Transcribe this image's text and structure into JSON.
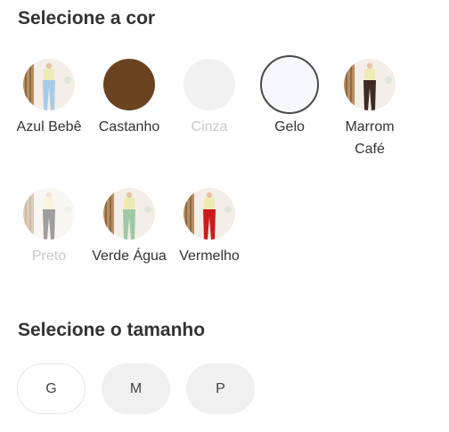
{
  "color_section": {
    "title": "Selecione a cor",
    "options": [
      {
        "label": "Azul Bebê",
        "kind": "photo",
        "garment_color": "#a9cbe6",
        "disabled": false,
        "selected": false
      },
      {
        "label": "Castanho",
        "kind": "solid",
        "color": "#6b4320",
        "disabled": false,
        "selected": false
      },
      {
        "label": "Cinza",
        "kind": "solid",
        "color": "#e0e0e0",
        "disabled": true,
        "selected": false
      },
      {
        "label": "Gelo",
        "kind": "solid",
        "color": "#f7f8fc",
        "disabled": false,
        "selected": true
      },
      {
        "label": "Marrom Café",
        "kind": "photo",
        "garment_color": "#3d2a22",
        "disabled": false,
        "selected": false
      },
      {
        "label": "Preto",
        "kind": "photo",
        "garment_color": "#2b2b2b",
        "disabled": true,
        "selected": false
      },
      {
        "label": "Verde Água",
        "kind": "photo",
        "garment_color": "#9ec9a6",
        "disabled": false,
        "selected": false
      },
      {
        "label": "Vermelho",
        "kind": "photo",
        "garment_color": "#cc1a1a",
        "disabled": false,
        "selected": false
      }
    ]
  },
  "size_section": {
    "title": "Selecione o tamanho",
    "options": [
      {
        "label": "G",
        "muted": false
      },
      {
        "label": "M",
        "muted": true
      },
      {
        "label": "P",
        "muted": true
      }
    ]
  }
}
